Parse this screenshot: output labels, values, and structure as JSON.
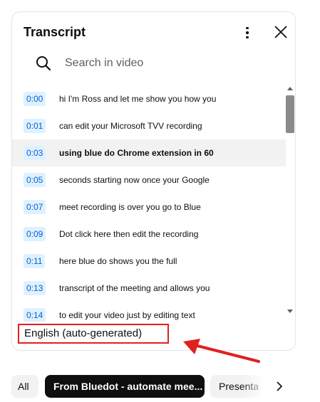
{
  "panel": {
    "title": "Transcript",
    "more_icon": "more-vert-icon",
    "close_icon": "close-icon"
  },
  "search": {
    "icon": "search-icon",
    "placeholder": "Search in video",
    "value": ""
  },
  "transcript": {
    "active_index": 2,
    "segments": [
      {
        "time": "0:00",
        "text": "hi I'm Ross and let me show you how you"
      },
      {
        "time": "0:01",
        "text": "can edit your Microsoft TVV recording"
      },
      {
        "time": "0:03",
        "text": "using blue do Chrome extension in 60"
      },
      {
        "time": "0:05",
        "text": "seconds starting now once your Google"
      },
      {
        "time": "0:07",
        "text": "meet recording is over you go to Blue"
      },
      {
        "time": "0:09",
        "text": "Dot click here then edit the recording"
      },
      {
        "time": "0:11",
        "text": "here blue do shows you the full"
      },
      {
        "time": "0:13",
        "text": "transcript of the meeting and allows you"
      },
      {
        "time": "0:14",
        "text": "to edit your video just by editing text"
      }
    ]
  },
  "language": {
    "label": "English (auto-generated)",
    "highlight_color": "#e02020"
  },
  "chips": {
    "items": [
      {
        "label": "All",
        "selected": false
      },
      {
        "label": "From Bluedot - automate mee...",
        "selected": true
      },
      {
        "label": "Presenta",
        "selected": false
      }
    ],
    "next_icon": "chevron-right-icon"
  },
  "colors": {
    "timestamp_text": "#065fd4",
    "timestamp_bg": "#def1ff",
    "active_row_bg": "#f2f2f2",
    "annotation_red": "#e02020"
  }
}
